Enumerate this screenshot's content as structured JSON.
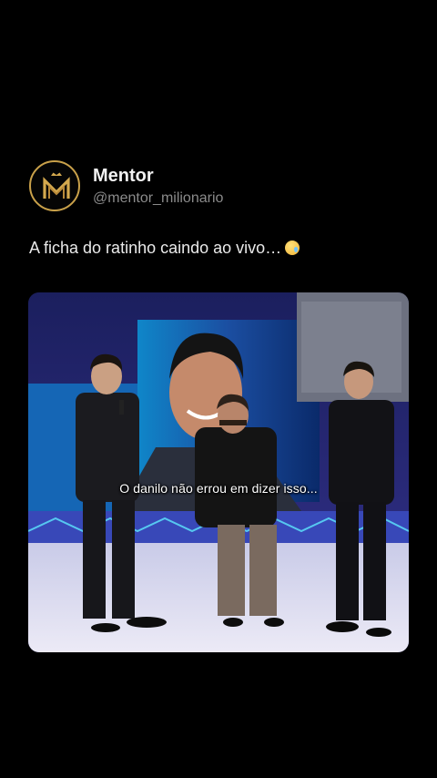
{
  "author": {
    "display_name": "Mentor",
    "handle": "@mentor_milionario",
    "avatar_icon": "mentor-crown-logo",
    "avatar_border_color": "#c9a14a"
  },
  "post": {
    "text": "A ficha do ratinho caindo ao vivo…",
    "emoji_icon": "crying-face-icon"
  },
  "video": {
    "caption": "O danilo não errou em dizer isso..."
  },
  "colors": {
    "background": "#000000",
    "handle": "#8b8b8b",
    "text": "#eaeaea"
  }
}
